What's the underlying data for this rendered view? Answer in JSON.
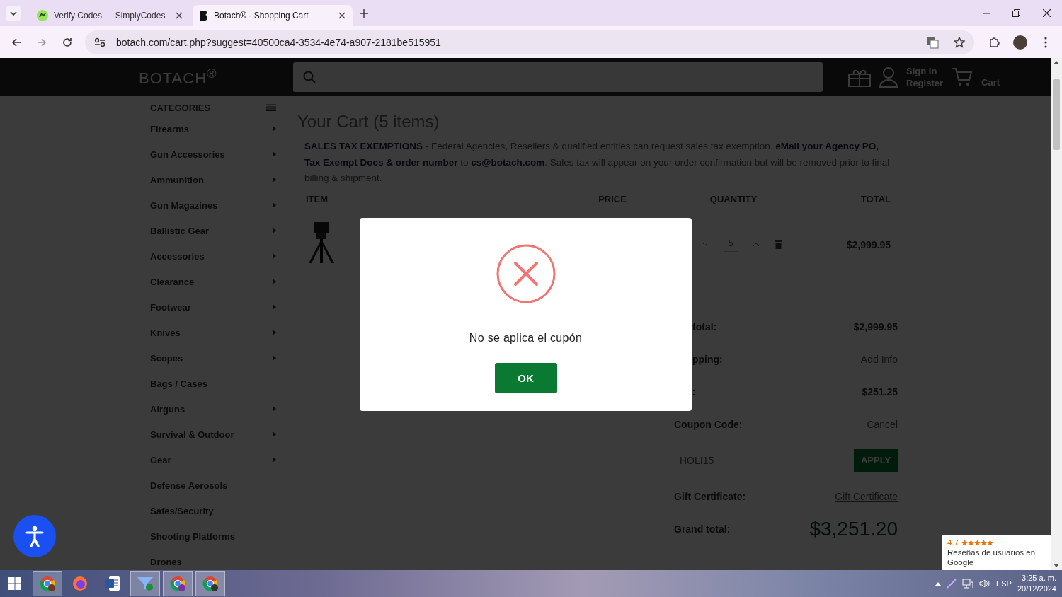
{
  "browser": {
    "tabs": [
      {
        "title": "Verify Codes — SimplyCodes",
        "selected": false
      },
      {
        "title": "Botach® - Shopping Cart",
        "selected": true
      }
    ],
    "url": "botach.com/cart.php?suggest=40500ca4-3534-4e74-a907-2181be515951"
  },
  "header": {
    "logo": "BOTACH$^{®}$",
    "sign_in": "Sign In",
    "register": "Register",
    "cart": "Cart"
  },
  "sidebar": {
    "title": "CATEGORIES",
    "items": [
      {
        "label": "Firearms",
        "has_submenu": true
      },
      {
        "label": "Gun Accessories",
        "has_submenu": true
      },
      {
        "label": "Ammunition",
        "has_submenu": true
      },
      {
        "label": "Gun Magazines",
        "has_submenu": true
      },
      {
        "label": "Ballistic Gear",
        "has_submenu": true
      },
      {
        "label": "Accessories",
        "has_submenu": true
      },
      {
        "label": "Clearance",
        "has_submenu": true
      },
      {
        "label": "Footwear",
        "has_submenu": true
      },
      {
        "label": "Knives",
        "has_submenu": true
      },
      {
        "label": "Scopes",
        "has_submenu": true
      },
      {
        "label": "Bags / Cases",
        "has_submenu": false
      },
      {
        "label": "Airguns",
        "has_submenu": true
      },
      {
        "label": "Survival & Outdoor",
        "has_submenu": true
      },
      {
        "label": "Gear",
        "has_submenu": true
      },
      {
        "label": "Defense Aerosols",
        "has_submenu": false
      },
      {
        "label": "Safes/Security",
        "has_submenu": false
      },
      {
        "label": "Shooting Platforms",
        "has_submenu": false
      },
      {
        "label": "Drones",
        "has_submenu": false
      }
    ]
  },
  "cart": {
    "title": "Your Cart (5 items)",
    "notice": "**SALES TAX EXEMPTIONS** - Federal Agencies, Resellers & qualified entities can request sales tax exemption. **eMail your Agency PO, Tax Exempt Docs & order number** to **cs@botach.com**. Sales tax will appear on your order confirmation but will be removed prior to final billing & shipment.",
    "columns": [
      "ITEM",
      "PRICE",
      "QUANTITY",
      "TOTAL"
    ],
    "rows": [
      {
        "quantity": "5",
        "total": "$2,999.95"
      }
    ],
    "summary": [
      {
        "label": "total:",
        "value": "$2,999.95",
        "kind": "text"
      },
      {
        "label": "pping:",
        "value": "Add Info",
        "kind": "link"
      },
      {
        "label": ":",
        "value": "$251.25",
        "kind": "text"
      },
      {
        "label": "Coupon Code:",
        "value": "Cancel",
        "kind": "link"
      },
      {
        "kind": "coupon",
        "value": "HOLI15",
        "button": "APPLY"
      },
      {
        "label": "Gift Certificate:",
        "value": "Gift Certificate",
        "kind": "link"
      },
      {
        "label": "Grand total:",
        "value": "$3,251.20",
        "kind": "grand"
      }
    ]
  },
  "dialog": {
    "message": "No se aplica el cupón",
    "button": "OK"
  },
  "reviews_badge": {
    "rating": "4.7",
    "stars": 5,
    "text": "Reseñas de usuarios en Google"
  },
  "taskbar": {
    "language": "ESP",
    "time": "3:25 a. m.",
    "date": "20/12/2024"
  }
}
